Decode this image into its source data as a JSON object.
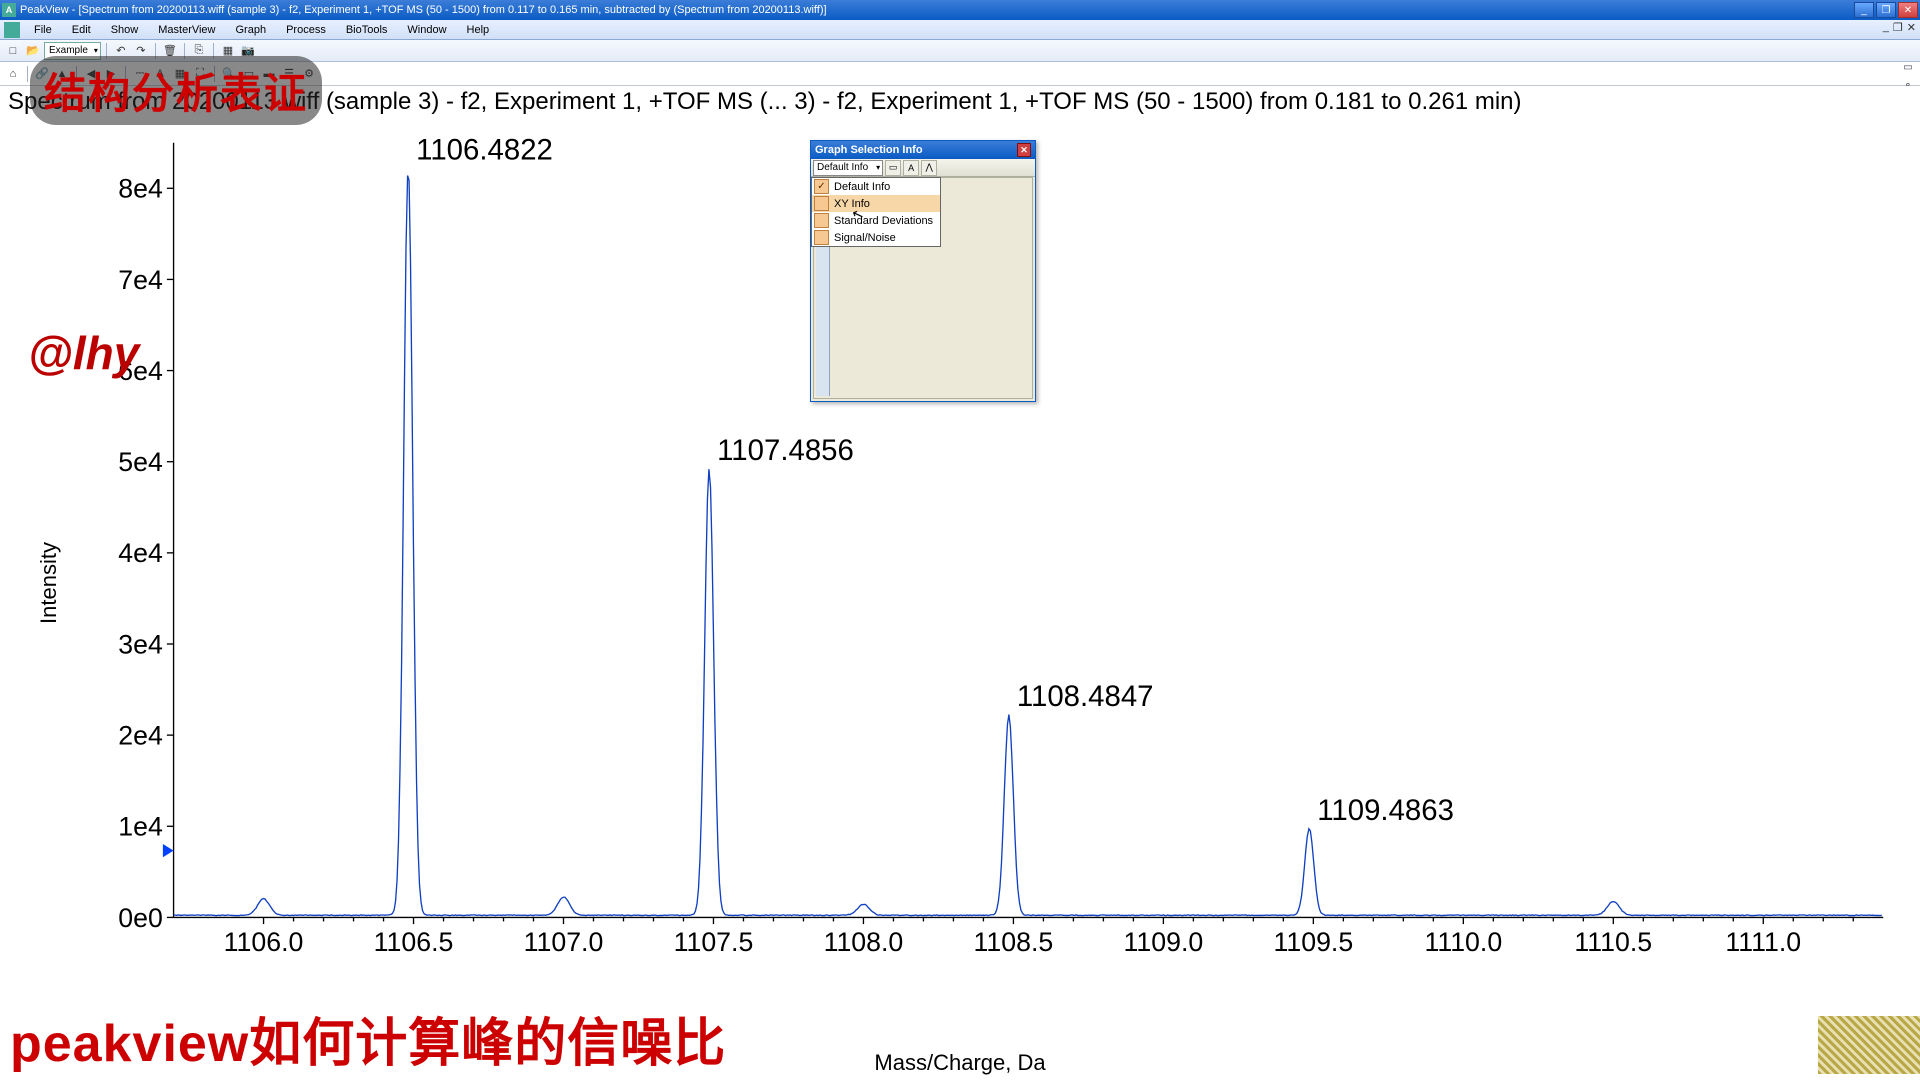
{
  "window": {
    "app_name": "PeakView",
    "title_suffix": "[Spectrum from 20200113.wiff (sample 3) - f2, Experiment 1, +TOF MS (50 - 1500) from 0.117 to 0.165 min, subtracted by (Spectrum from 20200113.wiff)]",
    "minimize": "_",
    "maximize": "❐",
    "close": "✕"
  },
  "menu": {
    "items": [
      "File",
      "Edit",
      "Show",
      "MasterView",
      "Graph",
      "Process",
      "BioTools",
      "Window",
      "Help"
    ]
  },
  "toolbar1": {
    "example_label": "Example"
  },
  "plot": {
    "title": "Spectrum from 20200113.wiff (sample 3) - f2, Experiment 1, +TOF MS (... 3) - f2, Experiment 1, +TOF MS (50 - 1500) from 0.181 to 0.261 min)",
    "ylabel": "Intensity",
    "xlabel": "Mass/Charge, Da",
    "y_ticks": [
      "0e0",
      "1e4",
      "2e4",
      "3e4",
      "4e4",
      "5e4",
      "6e4",
      "7e4",
      "8e4"
    ],
    "x_ticks": [
      "1106.0",
      "1106.5",
      "1107.0",
      "1107.5",
      "1108.0",
      "1108.5",
      "1109.0",
      "1109.5",
      "1110.0",
      "1110.5",
      "1111.0"
    ]
  },
  "chart_data": {
    "type": "line",
    "title": "Spectrum from 20200113.wiff (sample 3) - f2, Experiment 1, +TOF MS",
    "xlabel": "Mass/Charge, Da",
    "ylabel": "Intensity",
    "xlim": [
      1105.7,
      1111.4
    ],
    "ylim": [
      0,
      85000
    ],
    "peaks": [
      {
        "mz": 1106.4822,
        "intensity": 82000,
        "label": "1106.4822"
      },
      {
        "mz": 1107.4856,
        "intensity": 49000,
        "label": "1107.4856"
      },
      {
        "mz": 1108.4847,
        "intensity": 22000,
        "label": "1108.4847"
      },
      {
        "mz": 1109.4863,
        "intensity": 9500,
        "label": "1109.4863"
      }
    ],
    "minor_peaks": [
      {
        "mz": 1106.0,
        "intensity": 1800
      },
      {
        "mz": 1107.0,
        "intensity": 2000
      },
      {
        "mz": 1108.0,
        "intensity": 1200
      },
      {
        "mz": 1110.5,
        "intensity": 1500
      }
    ]
  },
  "float": {
    "title": "Graph Selection Info",
    "combo_label": "Default Info",
    "options": [
      {
        "label": "Default Info",
        "checked": true,
        "hover": false
      },
      {
        "label": "XY Info",
        "checked": false,
        "hover": true
      },
      {
        "label": "Standard Deviations",
        "checked": false,
        "hover": false
      },
      {
        "label": "Signal/Noise",
        "checked": false,
        "hover": false
      }
    ]
  },
  "overlays": {
    "pill": "结构分析表证",
    "at": "@lhy",
    "bottom": "peakview如何计算峰的信噪比"
  }
}
